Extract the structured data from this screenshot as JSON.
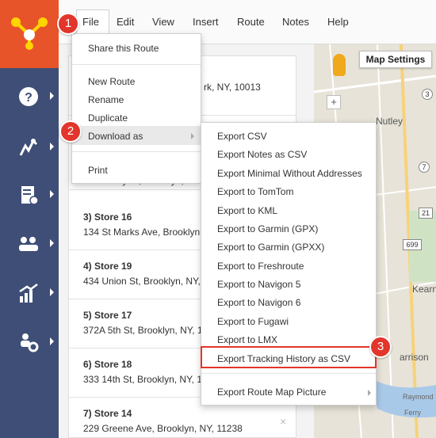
{
  "menubar": {
    "file": "File",
    "edit": "Edit",
    "view": "View",
    "insert": "Insert",
    "route": "Route",
    "notes": "Notes",
    "help": "Help"
  },
  "file_menu": {
    "items": [
      "Share this Route",
      "New Route",
      "Rename",
      "Duplicate",
      "Download as",
      "Print"
    ]
  },
  "download_submenu": {
    "items": [
      "Export CSV",
      "Export Notes as CSV",
      "Export Minimal Without Addresses",
      "Export to TomTom",
      "Export to KML",
      "Export to Garmin (GPX)",
      "Export to Garmin (GPXX)",
      "Export to Freshroute",
      "Export to Navigon 5",
      "Export to Navigon 6",
      "Export to Fugawi",
      "Export to LMX",
      "Export Tracking History as CSV",
      "Export Route Map Picture"
    ]
  },
  "route_list": {
    "top_address_fragment": "rk, NY, 10013",
    "partial_address": "559 Henry St, Brooklyn, NY",
    "stops": [
      {
        "name": "3) Store 16",
        "address": "134 St Marks Ave, Brooklyn"
      },
      {
        "name": "4) Store 19",
        "address": "434 Union St, Brooklyn, NY,"
      },
      {
        "name": "5) Store 17",
        "address": "372A 5th St, Brooklyn, NY, 1"
      },
      {
        "name": "6) Store 18",
        "address": "333 14th St, Brooklyn, NY, 1"
      },
      {
        "name": "7) Store 14",
        "address": "229 Greene Ave, Brooklyn, NY, 11238"
      }
    ],
    "remove_glyph": "×"
  },
  "map": {
    "settings_label": "Map Settings",
    "zoom_in": "+",
    "labels": [
      "Nutley",
      "Kearn",
      "arrison",
      "Raymond",
      "Ferry"
    ],
    "route_shields": [
      "3",
      "7",
      "21",
      "699"
    ]
  },
  "annotations": [
    "1",
    "2",
    "3"
  ],
  "colors": {
    "brand_orange": "#e8542a",
    "sidebar_navy": "#3e4e76",
    "callout_red": "#e2352b",
    "menu_highlight": "#e9e9e9"
  },
  "sidebar_icons": [
    "help-icon",
    "route-planner-icon",
    "addresses-icon",
    "team-icon",
    "reports-icon",
    "settings-icon"
  ]
}
